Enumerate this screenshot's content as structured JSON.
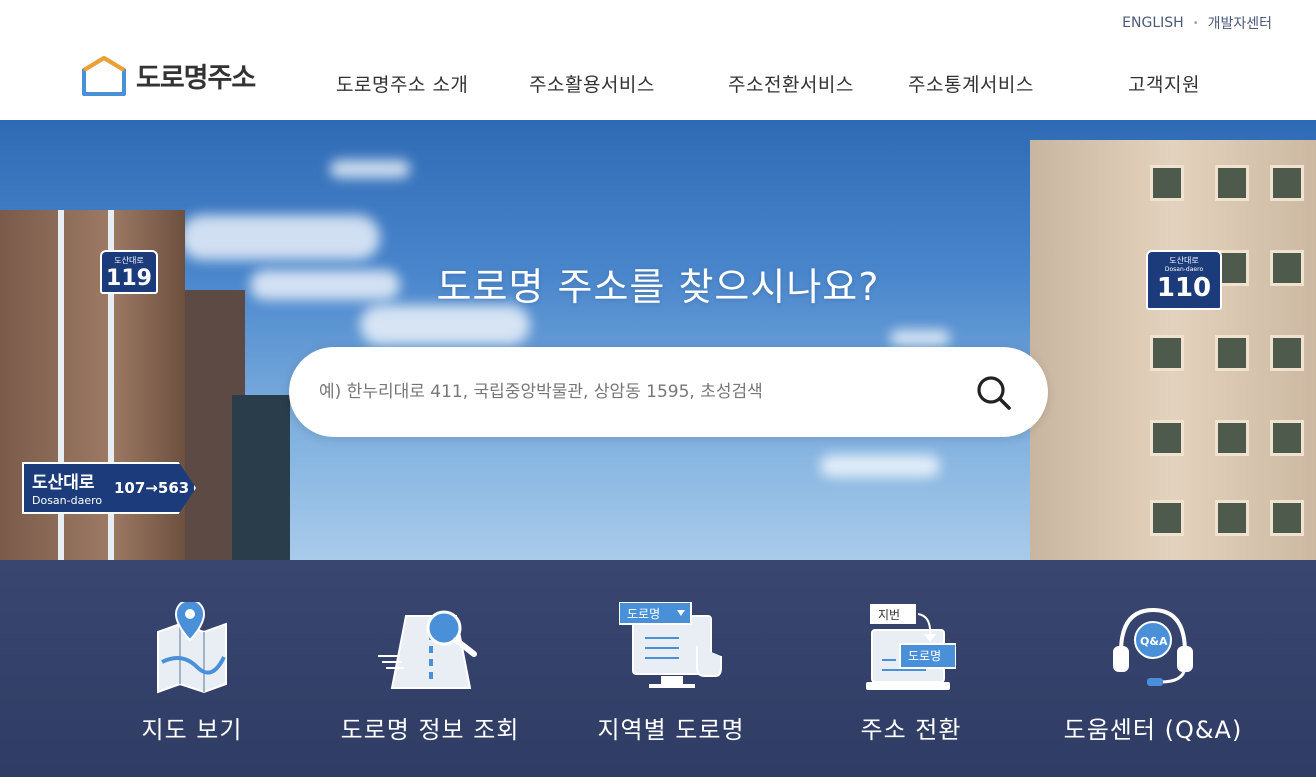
{
  "top_links": {
    "english": "ENGLISH",
    "developer": "개발자센터"
  },
  "logo": {
    "text": "도로명주소"
  },
  "gnb": [
    {
      "label": "도로명주소 소개"
    },
    {
      "label": "주소활용서비스"
    },
    {
      "label": "주소전환서비스"
    },
    {
      "label": "주소통계서비스"
    },
    {
      "label": "고객지원"
    }
  ],
  "hero": {
    "title": "도로명 주소를 찾으시나요?",
    "search_placeholder": "예) 한누리대로 411, 국립중앙박물관, 상암동 1595, 초성검색"
  },
  "signs": {
    "left_number": {
      "road": "도산대로",
      "number": "119"
    },
    "right_number": {
      "road": "도산대로",
      "road_en": "Dosan-daero",
      "number": "110"
    },
    "road_sign": {
      "kr": "도산대로",
      "en": "Dosan-daero",
      "range": "107→563"
    }
  },
  "quick_menu": [
    {
      "label": "지도 보기",
      "icon": "map-pin-icon"
    },
    {
      "label": "도로명 정보 조회",
      "icon": "road-search-icon"
    },
    {
      "label": "지역별 도로명",
      "icon": "region-road-icon",
      "badge": "도로명"
    },
    {
      "label": "주소 전환",
      "icon": "address-convert-icon",
      "from": "지번",
      "to": "도로명"
    },
    {
      "label": "도움센터 (Q&A)",
      "icon": "headset-icon",
      "badge": "Q&A"
    }
  ],
  "colors": {
    "nav_text": "#333333",
    "brand_blue": "#4a90d9",
    "brand_orange": "#f0a030",
    "quick_bg": "#34416b",
    "sign_blue": "#1b3b7a"
  }
}
